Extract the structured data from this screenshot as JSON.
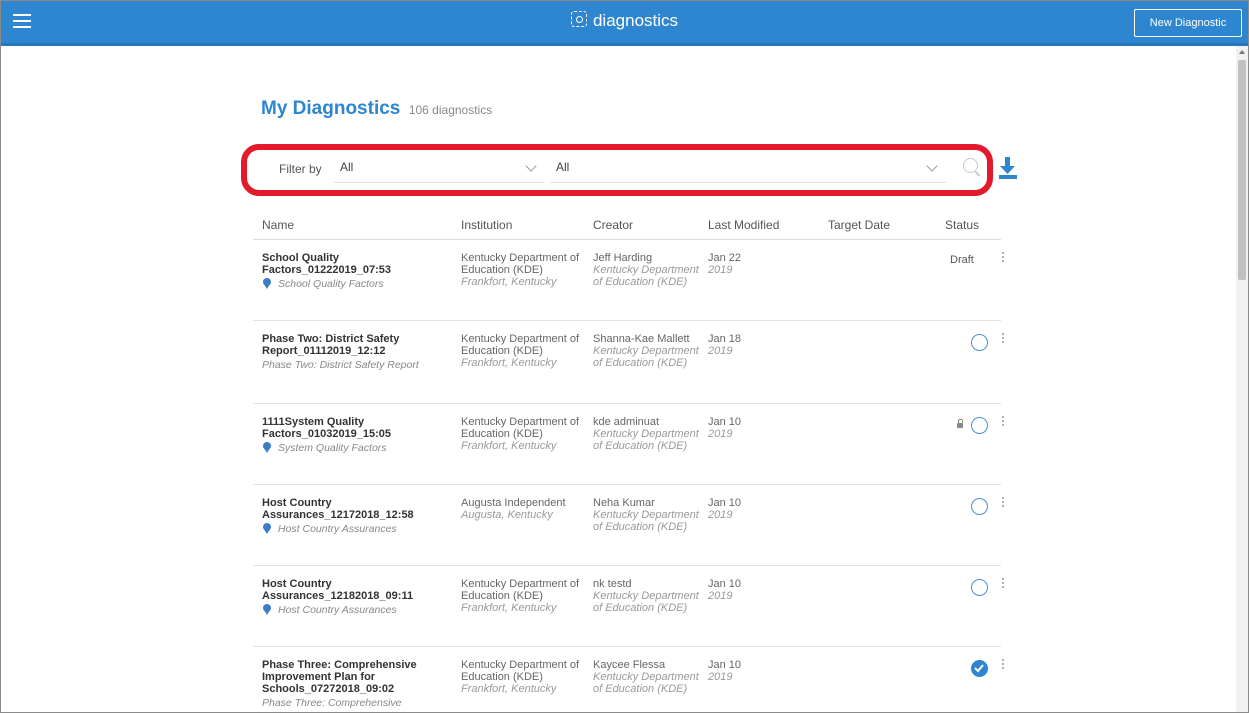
{
  "app": {
    "brand": "diagnostics",
    "new_button": "New Diagnostic"
  },
  "page": {
    "title": "My Diagnostics",
    "count": "106 diagnostics"
  },
  "filter": {
    "label": "Filter by",
    "select1_value": "All",
    "select2_value": "All"
  },
  "table": {
    "headers": {
      "name": "Name",
      "institution": "Institution",
      "creator": "Creator",
      "modified": "Last Modified",
      "target": "Target Date",
      "status": "Status"
    },
    "rows": [
      {
        "name": "School Quality Factors_01222019_07:53",
        "subtitle": "School Quality Factors",
        "inst": "Kentucky Department of Education (KDE)",
        "inst_loc": "Frankfort, Kentucky",
        "creator": "Jeff Harding",
        "creator_org": "Kentucky Department of Education (KDE)",
        "mod_date": "Jan 22",
        "mod_year": "2019",
        "status_text": "Draft"
      },
      {
        "name": "Phase Two: District Safety Report_01112019_12:12",
        "subtitle": "Phase Two: District Safety Report",
        "inst": "Kentucky Department of Education (KDE)",
        "inst_loc": "Frankfort, Kentucky",
        "creator": "Shanna-Kae Mallett",
        "creator_org": "Kentucky Department of Education (KDE)",
        "mod_date": "Jan 18",
        "mod_year": "2019",
        "status_text": ""
      },
      {
        "name": "1111System Quality Factors_01032019_15:05",
        "subtitle": "System Quality Factors",
        "inst": "Kentucky Department of Education (KDE)",
        "inst_loc": "Frankfort, Kentucky",
        "creator": "kde adminuat",
        "creator_org": "Kentucky Department of Education (KDE)",
        "mod_date": "Jan 10",
        "mod_year": "2019",
        "status_text": ""
      },
      {
        "name": "Host Country Assurances_12172018_12:58",
        "subtitle": "Host Country Assurances",
        "inst": "Augusta Independent",
        "inst_loc": "Augusta, Kentucky",
        "creator": "Neha Kumar",
        "creator_org": "Kentucky Department of Education (KDE)",
        "mod_date": "Jan 10",
        "mod_year": "2019",
        "status_text": ""
      },
      {
        "name": "Host Country Assurances_12182018_09:11",
        "subtitle": "Host Country Assurances",
        "inst": "Kentucky Department of Education (KDE)",
        "inst_loc": "Frankfort, Kentucky",
        "creator": "nk testd",
        "creator_org": "Kentucky Department of Education (KDE)",
        "mod_date": "Jan 10",
        "mod_year": "2019",
        "status_text": ""
      },
      {
        "name": "Phase Three: Comprehensive Improvement Plan for Schools_07272018_09:02",
        "subtitle": "Phase Three: Comprehensive",
        "inst": "Kentucky Department of Education (KDE)",
        "inst_loc": "Frankfort, Kentucky",
        "creator": "Kaycee Flessa",
        "creator_org": "Kentucky Department of Education (KDE)",
        "mod_date": "Jan 10",
        "mod_year": "2019",
        "status_text": ""
      }
    ]
  },
  "colors": {
    "brand_blue": "#2e86d1",
    "highlight_red": "#e3192c"
  }
}
